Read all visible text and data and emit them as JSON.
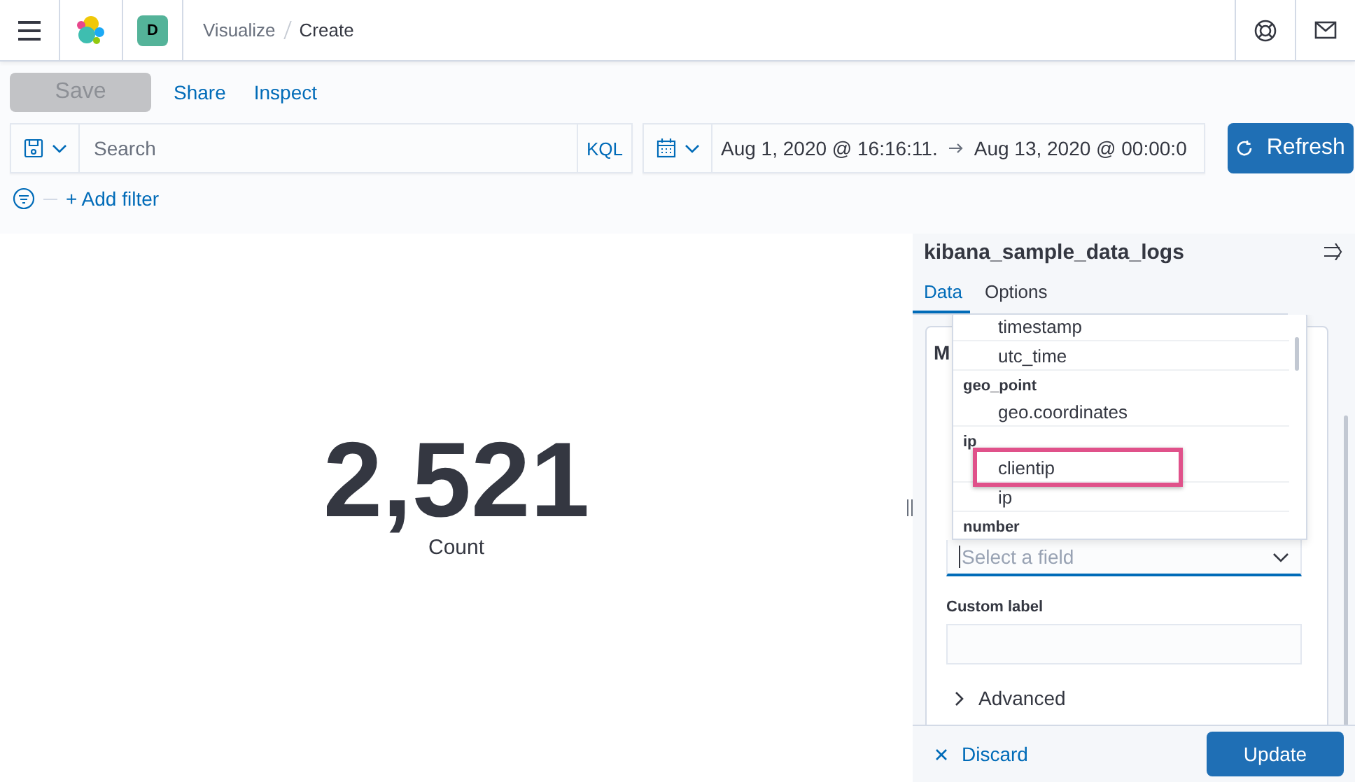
{
  "header": {
    "space_avatar": "D",
    "breadcrumbs": [
      {
        "label": "Visualize",
        "current": false
      },
      {
        "label": "Create",
        "current": true
      }
    ]
  },
  "toolbar": {
    "buttons": [
      {
        "label": "Save",
        "kind": "button",
        "disabled": true
      },
      {
        "label": "Share",
        "kind": "link",
        "disabled": false
      },
      {
        "label": "Inspect",
        "kind": "link",
        "disabled": false
      }
    ]
  },
  "query": {
    "placeholder": "Search",
    "language": "KQL",
    "start": "Aug 1, 2020 @ 16:16:11.",
    "end": "Aug 13, 2020 @ 00:00:0",
    "refresh": "Refresh"
  },
  "filter": {
    "add": "+ Add filter"
  },
  "metric": {
    "value": "2,521",
    "label": "Count"
  },
  "sidebar": {
    "title": "kibana_sample_data_logs",
    "tabs": [
      {
        "label": "Data",
        "selected": true
      },
      {
        "label": "Options",
        "selected": false
      }
    ],
    "card_title": "M",
    "field_select": {
      "placeholder": "Select a field",
      "rows": [
        {
          "kind": "option",
          "label": "timestamp",
          "highlighted": false
        },
        {
          "kind": "option",
          "label": "utc_time",
          "highlighted": false
        },
        {
          "kind": "group",
          "label": "geo_point"
        },
        {
          "kind": "option",
          "label": "geo.coordinates",
          "highlighted": false
        },
        {
          "kind": "group",
          "label": "ip"
        },
        {
          "kind": "option",
          "label": "clientip",
          "highlighted": true
        },
        {
          "kind": "option",
          "label": "ip",
          "highlighted": false
        },
        {
          "kind": "group",
          "label": "number"
        }
      ]
    },
    "custom_label": "Custom label",
    "advanced": "Advanced",
    "discard": "Discard",
    "update": "Update"
  }
}
